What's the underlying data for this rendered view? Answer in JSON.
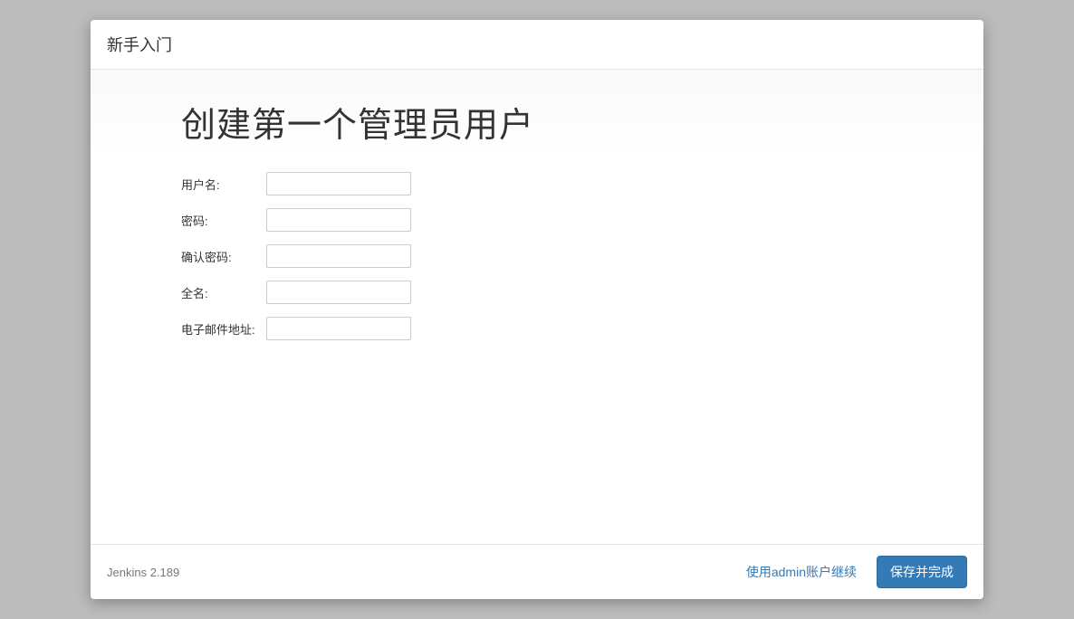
{
  "header": {
    "title": "新手入门"
  },
  "main": {
    "heading": "创建第一个管理员用户",
    "fields": {
      "username": {
        "label": "用户名:",
        "value": ""
      },
      "password": {
        "label": "密码:",
        "value": ""
      },
      "confirm_password": {
        "label": "确认密码:",
        "value": ""
      },
      "fullname": {
        "label": "全名:",
        "value": ""
      },
      "email": {
        "label": "电子邮件地址:",
        "value": ""
      }
    }
  },
  "footer": {
    "version": "Jenkins 2.189",
    "skip_button": "使用admin账户继续",
    "save_button": "保存并完成"
  }
}
